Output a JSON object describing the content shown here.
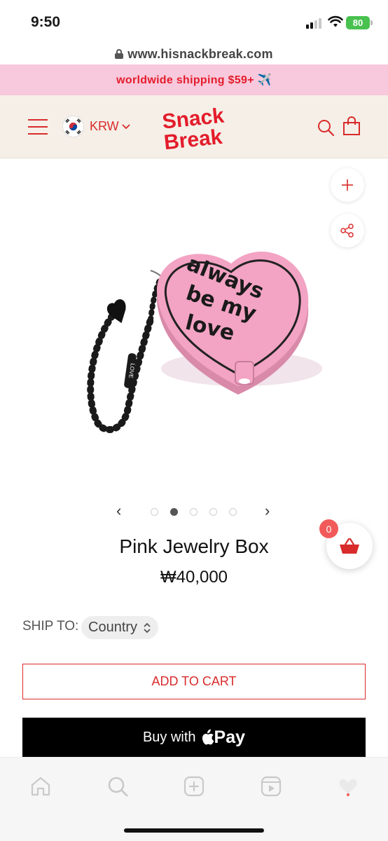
{
  "status_bar": {
    "time": "9:50",
    "battery": "80"
  },
  "browser": {
    "url": "www.hisnackbreak.com"
  },
  "promo": {
    "text": "worldwide shipping $59+ ✈️"
  },
  "header": {
    "currency": "KRW",
    "logo_line1": "Snack",
    "logo_line2": "Break"
  },
  "product": {
    "title": "Pink Jewelry Box",
    "price": "₩40,000",
    "image_text": [
      "always",
      "be my",
      "love"
    ],
    "strap_text": "LOVE"
  },
  "carousel": {
    "prev": "‹",
    "next": "›",
    "slide_count": 5,
    "active_index": 1
  },
  "cart": {
    "count": "0"
  },
  "shipping": {
    "label": "SHIP TO:",
    "country": "Country"
  },
  "buttons": {
    "add_to_cart": "ADD TO CART",
    "buy_with": "Buy with",
    "pay": "Pay"
  },
  "bottom_nav": [
    "home-icon",
    "search-icon",
    "add-icon",
    "reels-icon",
    "heart-icon"
  ],
  "colors": {
    "brand_red": "#d92b2b",
    "promo_pink": "#f8c8dc",
    "header_bg": "#f5efe7",
    "box_pink": "#f3a3c3"
  }
}
